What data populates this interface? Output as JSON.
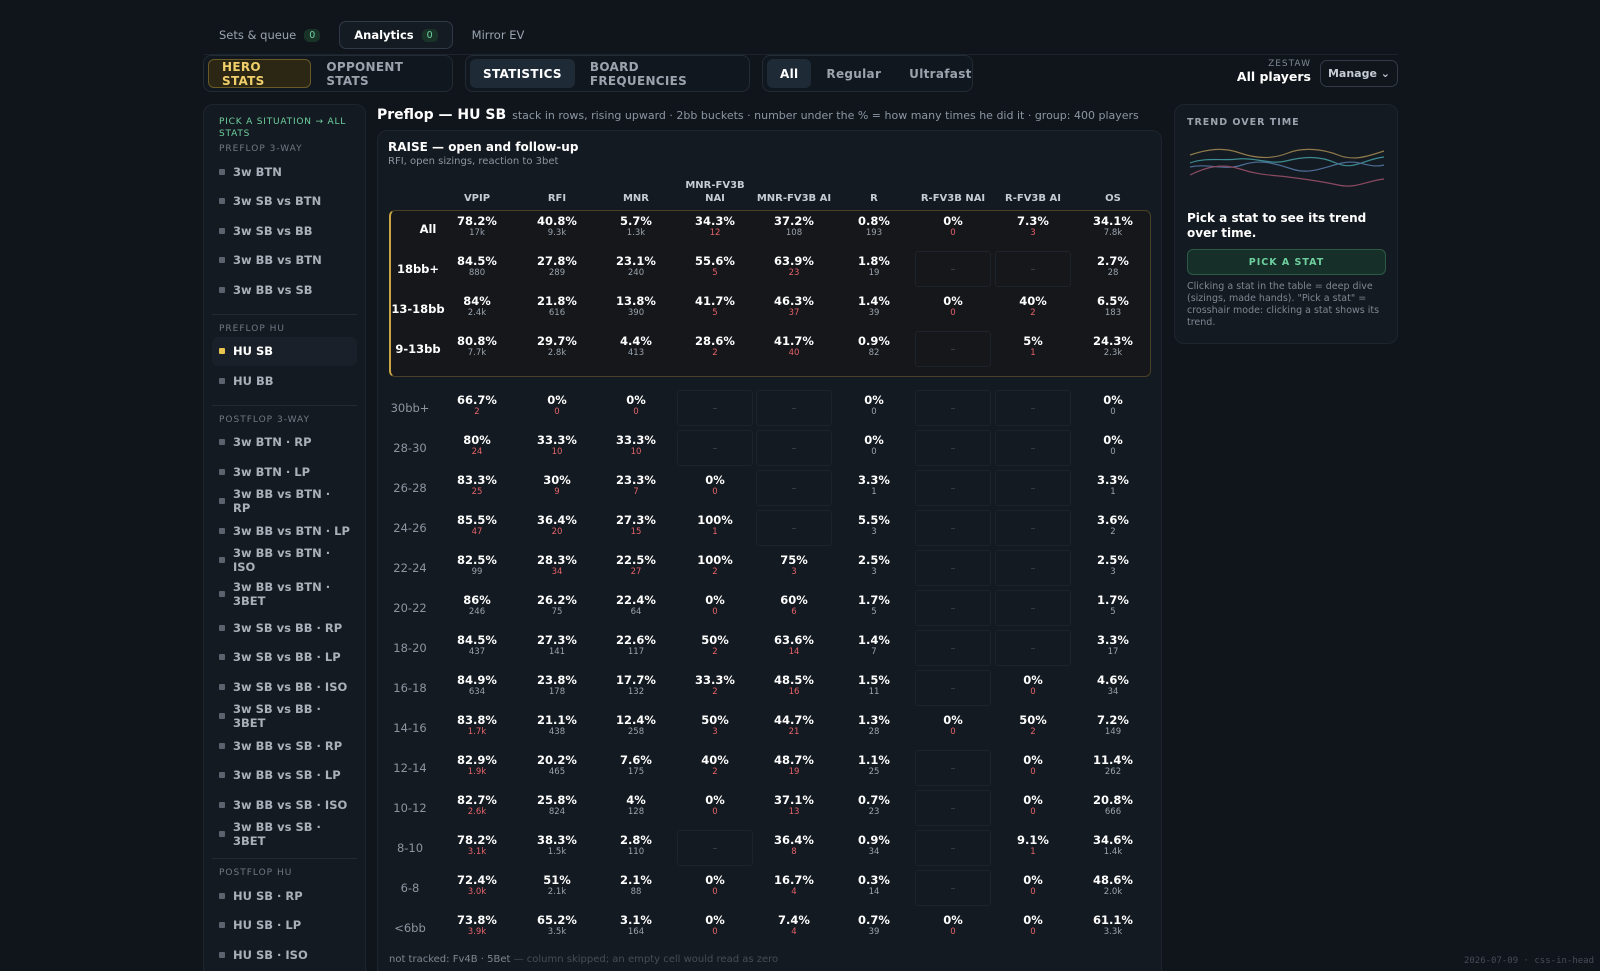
{
  "top_nav": [
    {
      "label": "Sets & queue",
      "count": "0",
      "active": false
    },
    {
      "label": "Analytics",
      "count": "0",
      "active": true
    },
    {
      "label": "Mirror EV",
      "count": null,
      "active": false
    }
  ],
  "stats_toggle": [
    "HERO STATS",
    "OPPONENT STATS"
  ],
  "view_toggle": [
    "STATISTICS",
    "BOARD FREQUENCIES"
  ],
  "speed_filter": [
    "All",
    "Regular",
    "Ultrafast"
  ],
  "player": {
    "label": "ZESTAW",
    "value": "All players"
  },
  "manage_label": "Manage ⌄",
  "sidebar": {
    "pick": "PICK A SITUATION → ALL STATS",
    "active": "HU SB",
    "groups": [
      {
        "head": "PREFLOP 3-WAY",
        "items": [
          "3w BTN",
          "3w SB vs BTN",
          "3w SB vs BB",
          "3w BB vs BTN",
          "3w BB vs SB"
        ]
      },
      {
        "head": "PREFLOP HU",
        "items": [
          "HU SB",
          "HU BB"
        ]
      },
      {
        "head": "POSTFLOP 3-WAY",
        "items": [
          "3w BTN · RP",
          "3w BTN · LP",
          "3w BB vs BTN · RP",
          "3w BB vs BTN · LP",
          "3w BB vs BTN · ISO",
          "3w BB vs BTN · 3BET",
          "3w SB vs BB · RP",
          "3w SB vs BB · LP",
          "3w SB vs BB · ISO",
          "3w SB vs BB · 3BET",
          "3w BB vs SB · RP",
          "3w BB vs SB · LP",
          "3w BB vs SB · ISO",
          "3w BB vs SB · 3BET"
        ]
      },
      {
        "head": "POSTFLOP HU",
        "items": [
          "HU SB · RP",
          "HU SB · LP",
          "HU SB · ISO"
        ]
      }
    ]
  },
  "page": {
    "title": "Preflop — HU SB",
    "subtitle": "stack in rows, rising upward · 2bb buckets · number under the % = how many times he did it · group: 400 players"
  },
  "table": {
    "title": "RAISE — open and follow-up",
    "subtitle": "RFI, open sizings, reaction to 3bet",
    "columns": [
      "VPIP",
      "RFI",
      "MNR",
      "MNR-FV3B NAI",
      "MNR-FV3B AI",
      "R",
      "R-FV3B NAI",
      "R-FV3B AI",
      "OS"
    ],
    "group_rows": [
      {
        "label": "All",
        "cells": [
          [
            "78.2%",
            "17k"
          ],
          [
            "40.8%",
            "9.3k"
          ],
          [
            "5.7%",
            "1.3k"
          ],
          [
            "34.3%",
            "12"
          ],
          [
            "37.2%",
            "108"
          ],
          [
            "0.8%",
            "193"
          ],
          [
            "0%",
            "0"
          ],
          [
            "7.3%",
            "3"
          ],
          [
            "34.1%",
            "7.8k"
          ]
        ]
      },
      {
        "label": "18bb+",
        "cells": [
          [
            "84.5%",
            "880"
          ],
          [
            "27.8%",
            "289"
          ],
          [
            "23.1%",
            "240"
          ],
          [
            "55.6%",
            "5"
          ],
          [
            "63.9%",
            "23"
          ],
          [
            "1.8%",
            "19"
          ],
          null,
          null,
          [
            "2.7%",
            "28"
          ]
        ]
      },
      {
        "label": "13-18bb",
        "cells": [
          [
            "84%",
            "2.4k"
          ],
          [
            "21.8%",
            "616"
          ],
          [
            "13.8%",
            "390"
          ],
          [
            "41.7%",
            "5"
          ],
          [
            "46.3%",
            "37"
          ],
          [
            "1.4%",
            "39"
          ],
          [
            "0%",
            "0"
          ],
          [
            "40%",
            "2"
          ],
          [
            "6.5%",
            "183"
          ]
        ]
      },
      {
        "label": "9-13bb",
        "cells": [
          [
            "80.8%",
            "7.7k"
          ],
          [
            "29.7%",
            "2.8k"
          ],
          [
            "4.4%",
            "413"
          ],
          [
            "28.6%",
            "2"
          ],
          [
            "41.7%",
            "40"
          ],
          [
            "0.9%",
            "82"
          ],
          null,
          [
            "5%",
            "1"
          ],
          [
            "24.3%",
            "2.3k"
          ]
        ]
      }
    ],
    "bucket_rows": [
      {
        "label": "30bb+",
        "cells": [
          [
            "66.7%",
            "2"
          ],
          [
            "0%",
            "0"
          ],
          [
            "0%",
            "0"
          ],
          null,
          null,
          [
            "0%",
            "0"
          ],
          null,
          null,
          [
            "0%",
            "0"
          ]
        ]
      },
      {
        "label": "28-30",
        "cells": [
          [
            "80%",
            "24"
          ],
          [
            "33.3%",
            "10"
          ],
          [
            "33.3%",
            "10"
          ],
          null,
          null,
          [
            "0%",
            "0"
          ],
          null,
          null,
          [
            "0%",
            "0"
          ]
        ]
      },
      {
        "label": "26-28",
        "cells": [
          [
            "83.3%",
            "25"
          ],
          [
            "30%",
            "9"
          ],
          [
            "23.3%",
            "7"
          ],
          [
            "0%",
            "0"
          ],
          null,
          [
            "3.3%",
            "1"
          ],
          null,
          null,
          [
            "3.3%",
            "1"
          ]
        ]
      },
      {
        "label": "24-26",
        "cells": [
          [
            "85.5%",
            "47"
          ],
          [
            "36.4%",
            "20"
          ],
          [
            "27.3%",
            "15"
          ],
          [
            "100%",
            "1"
          ],
          null,
          [
            "5.5%",
            "3"
          ],
          null,
          null,
          [
            "3.6%",
            "2"
          ]
        ]
      },
      {
        "label": "22-24",
        "cells": [
          [
            "82.5%",
            "99"
          ],
          [
            "28.3%",
            "34"
          ],
          [
            "22.5%",
            "27"
          ],
          [
            "100%",
            "2"
          ],
          [
            "75%",
            "3"
          ],
          [
            "2.5%",
            "3"
          ],
          null,
          null,
          [
            "2.5%",
            "3"
          ]
        ]
      },
      {
        "label": "20-22",
        "cells": [
          [
            "86%",
            "246"
          ],
          [
            "26.2%",
            "75"
          ],
          [
            "22.4%",
            "64"
          ],
          [
            "0%",
            "0"
          ],
          [
            "60%",
            "6"
          ],
          [
            "1.7%",
            "5"
          ],
          null,
          null,
          [
            "1.7%",
            "5"
          ]
        ]
      },
      {
        "label": "18-20",
        "cells": [
          [
            "84.5%",
            "437"
          ],
          [
            "27.3%",
            "141"
          ],
          [
            "22.6%",
            "117"
          ],
          [
            "50%",
            "2"
          ],
          [
            "63.6%",
            "14"
          ],
          [
            "1.4%",
            "7"
          ],
          null,
          null,
          [
            "3.3%",
            "17"
          ]
        ]
      },
      {
        "label": "16-18",
        "cells": [
          [
            "84.9%",
            "634"
          ],
          [
            "23.8%",
            "178"
          ],
          [
            "17.7%",
            "132"
          ],
          [
            "33.3%",
            "2"
          ],
          [
            "48.5%",
            "16"
          ],
          [
            "1.5%",
            "11"
          ],
          null,
          [
            "0%",
            "0"
          ],
          [
            "4.6%",
            "34"
          ]
        ]
      },
      {
        "label": "14-16",
        "cells": [
          [
            "83.8%",
            "1.7k"
          ],
          [
            "21.1%",
            "438"
          ],
          [
            "12.4%",
            "258"
          ],
          [
            "50%",
            "3"
          ],
          [
            "44.7%",
            "21"
          ],
          [
            "1.3%",
            "28"
          ],
          [
            "0%",
            "0"
          ],
          [
            "50%",
            "2"
          ],
          [
            "7.2%",
            "149"
          ]
        ]
      },
      {
        "label": "12-14",
        "cells": [
          [
            "82.9%",
            "1.9k"
          ],
          [
            "20.2%",
            "465"
          ],
          [
            "7.6%",
            "175"
          ],
          [
            "40%",
            "2"
          ],
          [
            "48.7%",
            "19"
          ],
          [
            "1.1%",
            "25"
          ],
          null,
          [
            "0%",
            "0"
          ],
          [
            "11.4%",
            "262"
          ]
        ]
      },
      {
        "label": "10-12",
        "cells": [
          [
            "82.7%",
            "2.6k"
          ],
          [
            "25.8%",
            "824"
          ],
          [
            "4%",
            "128"
          ],
          [
            "0%",
            "0"
          ],
          [
            "37.1%",
            "13"
          ],
          [
            "0.7%",
            "23"
          ],
          null,
          [
            "0%",
            "0"
          ],
          [
            "20.8%",
            "666"
          ]
        ]
      },
      {
        "label": "8-10",
        "cells": [
          [
            "78.2%",
            "3.1k"
          ],
          [
            "38.3%",
            "1.5k"
          ],
          [
            "2.8%",
            "110"
          ],
          null,
          [
            "36.4%",
            "8"
          ],
          [
            "0.9%",
            "34"
          ],
          null,
          [
            "9.1%",
            "1"
          ],
          [
            "34.6%",
            "1.4k"
          ]
        ]
      },
      {
        "label": "6-8",
        "cells": [
          [
            "72.4%",
            "3.0k"
          ],
          [
            "51%",
            "2.1k"
          ],
          [
            "2.1%",
            "88"
          ],
          [
            "0%",
            "0"
          ],
          [
            "16.7%",
            "4"
          ],
          [
            "0.3%",
            "14"
          ],
          null,
          [
            "0%",
            "0"
          ],
          [
            "48.6%",
            "2.0k"
          ]
        ]
      },
      {
        "label": "<6bb",
        "cells": [
          [
            "73.8%",
            "3.9k"
          ],
          [
            "65.2%",
            "3.5k"
          ],
          [
            "3.1%",
            "164"
          ],
          [
            "0%",
            "0"
          ],
          [
            "7.4%",
            "4"
          ],
          [
            "0.7%",
            "39"
          ],
          [
            "0%",
            "0"
          ],
          [
            "0%",
            "0"
          ],
          [
            "61.1%",
            "3.3k"
          ]
        ]
      }
    ],
    "empty_mark": "–",
    "footer_a": "not tracked: Fv4B · 5Bet",
    "footer_b": "— column skipped; an empty cell would read as zero"
  },
  "trend": {
    "label": "TREND OVER TIME",
    "heading": "Pick a stat to see its trend over time.",
    "button": "PICK A STAT",
    "help": "Clicking a stat in the table = deep dive (sizings, made hands). \"Pick a stat\" = crosshair mode: clicking a stat shows its trend.",
    "colors": [
      "#8f7a4c",
      "#3c8c92",
      "#4d6f97",
      "#8a4a62"
    ]
  },
  "stamp": "2026-07-09 · css-in-head"
}
